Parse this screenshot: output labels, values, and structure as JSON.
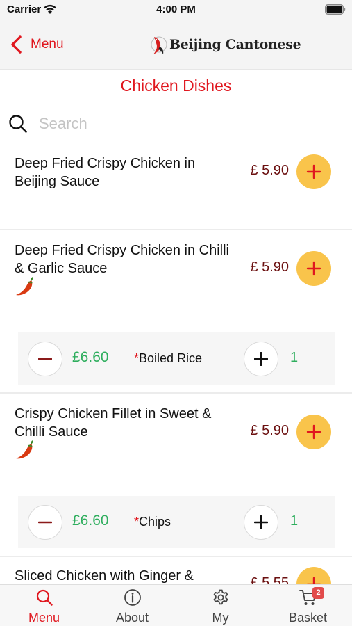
{
  "status_bar": {
    "carrier": "Carrier",
    "time": "4:00 PM"
  },
  "nav": {
    "back_label": "Menu",
    "logo_text": "Beijing Cantonese"
  },
  "page_title": "Chicken Dishes",
  "search": {
    "placeholder": "Search",
    "value": ""
  },
  "colors": {
    "accent": "#e0171f",
    "add_button": "#f9c44b",
    "price": "#6b1010",
    "option_price": "#2fae5e"
  },
  "dishes": [
    {
      "name": "Deep Fried Crispy Chicken in Beijing Sauce",
      "price": "£ 5.90",
      "spicy": false
    },
    {
      "name": "Deep Fried Crispy Chicken in Chilli & Garlic Sauce",
      "price": "£ 5.90",
      "spicy": true,
      "option": {
        "price": "£6.60",
        "required_mark": "*",
        "label": "Boiled Rice",
        "quantity": "1"
      }
    },
    {
      "name": "Crispy Chicken Fillet in Sweet & Chilli Sauce",
      "price": "£ 5.90",
      "spicy": true,
      "option": {
        "price": "£6.60",
        "required_mark": "*",
        "label": "Chips",
        "quantity": "1"
      }
    },
    {
      "name": "Sliced Chicken with Ginger &",
      "price": "£ 5.55",
      "spicy": false
    }
  ],
  "tabs": [
    {
      "label": "Menu",
      "icon": "search-icon",
      "active": true
    },
    {
      "label": "About",
      "icon": "info-icon",
      "active": false
    },
    {
      "label": "My",
      "icon": "gear-icon",
      "active": false
    },
    {
      "label": "Basket",
      "icon": "cart-icon",
      "active": false,
      "badge": "2"
    }
  ]
}
